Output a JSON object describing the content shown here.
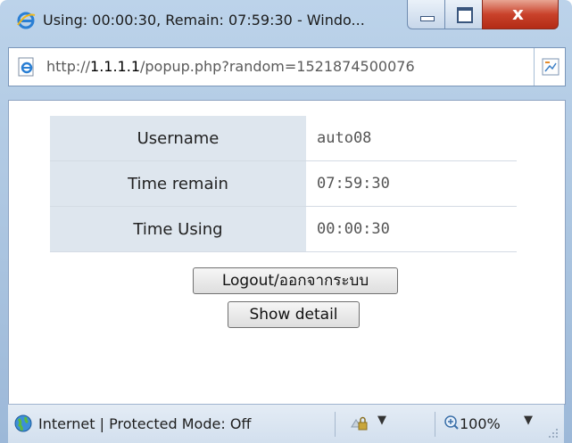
{
  "window": {
    "title": "Using: 00:00:30, Remain: 07:59:30 - Windo...",
    "minimize_label": "",
    "maximize_label": "",
    "close_label": "x"
  },
  "address": {
    "prefix": "http://",
    "host": "1.1.1.1",
    "path": "/popup.php?random=1521874500076",
    "page_icon": "ie-page-icon",
    "feed_icon": "rss-feed-icon"
  },
  "info_table": {
    "rows": [
      {
        "label": "Username",
        "value": "auto08"
      },
      {
        "label": "Time remain",
        "value": "07:59:30"
      },
      {
        "label": "Time Using",
        "value": "00:00:30"
      }
    ]
  },
  "buttons": {
    "logout_label": "Logout/ออกจากระบบ",
    "show_detail_label": "Show detail"
  },
  "status": {
    "zone_text": "Internet | Protected Mode: Off",
    "zoom_text": "100%",
    "icons": [
      "globe-icon",
      "lock-icon",
      "zoom-icon"
    ]
  },
  "colors": {
    "label_cell_bg": "#dee6ee",
    "close_button": "#c9422b",
    "frame": "#a9c3df"
  }
}
